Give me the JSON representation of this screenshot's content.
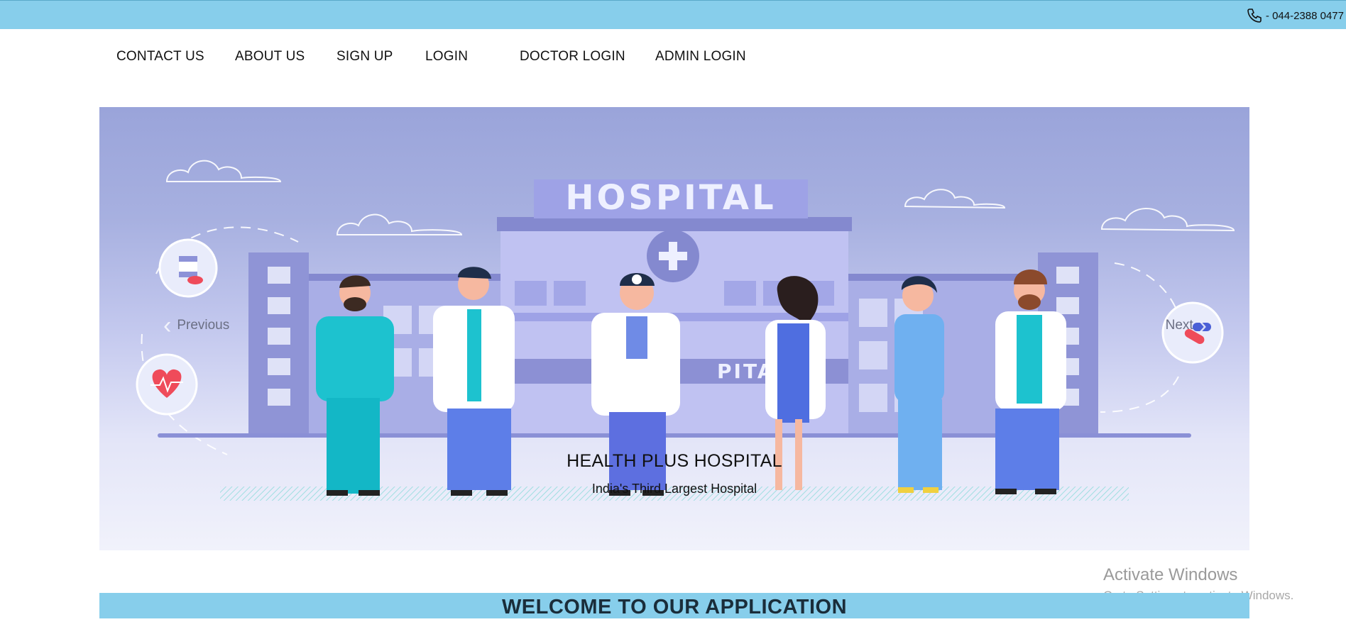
{
  "topbar": {
    "phone_icon": "phone-icon",
    "phone_text": "- 044-2388 0477",
    "color": "#87ceeb"
  },
  "nav": {
    "items": [
      {
        "label": "CONTACT US"
      },
      {
        "label": "ABOUT US"
      },
      {
        "label": "SIGN UP"
      },
      {
        "label": "LOGIN"
      },
      {
        "label": "DOCTOR LOGIN"
      },
      {
        "label": "ADMIN LOGIN"
      }
    ]
  },
  "carousel": {
    "sign_text": "HOSPITAL",
    "sign_text_partial": "PITAL",
    "prev_label": "Previous",
    "next_label": "Next",
    "caption_title": "HEALTH PLUS HOSPITAL",
    "caption_subtitle": "India's Third Largest Hospital"
  },
  "welcome": {
    "text": "WELCOME TO OUR APPLICATION",
    "color": "#87ceeb"
  },
  "watermark": {
    "title": "Activate Windows",
    "subtitle": "Go to Settings to activate Windows."
  }
}
